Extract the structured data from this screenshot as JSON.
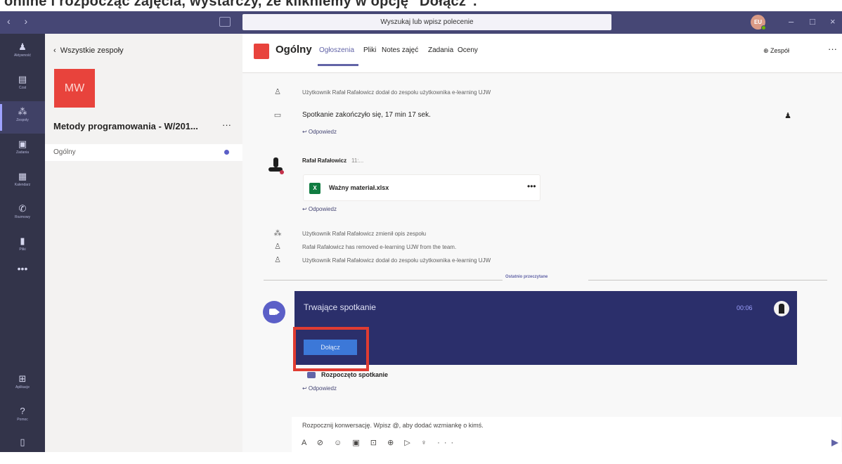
{
  "caption": "online i rozpocząć zajęcia, wystarczy, że klikniemy w opcję \"Dołącz\".",
  "titlebar": {
    "search_placeholder": "Wyszukaj lub wpisz polecenie",
    "avatar_initials": "EU",
    "minimize": "–",
    "maximize": "□",
    "close": "×"
  },
  "rail": {
    "items": [
      {
        "label": "Aktywność",
        "icon": "bell-icon"
      },
      {
        "label": "Czat",
        "icon": "chat-icon"
      },
      {
        "label": "Zespoły",
        "icon": "teams-icon"
      },
      {
        "label": "Zadania",
        "icon": "assignments-icon"
      },
      {
        "label": "Kalendarz",
        "icon": "calendar-icon"
      },
      {
        "label": "Rozmowy",
        "icon": "calls-icon"
      },
      {
        "label": "Pliki",
        "icon": "files-icon"
      }
    ],
    "more": "•••",
    "bottom": [
      {
        "label": "Aplikacje",
        "icon": "apps-icon"
      },
      {
        "label": "Pomoc",
        "icon": "help-icon"
      }
    ]
  },
  "teams_panel": {
    "back_label": "Wszystkie zespoły",
    "team_initials": "MW",
    "team_name": "Metody programowania - W/201...",
    "team_more": "···",
    "channel": "Ogólny"
  },
  "channel_header": {
    "name": "Ogólny",
    "tabs": [
      "Ogłoszenia",
      "Pliki",
      "Notes zajęć",
      "Zadania",
      "Oceny"
    ],
    "team_button": "⊕ Zespół",
    "more": "···"
  },
  "feed": {
    "sys1": "Użytkownik Rafał Rafałowicz dodał do zespołu użytkownika e-learning UJW",
    "meeting_ended": "Spotkanie zakończyło się, 17 min 17 sek.",
    "reply_label": "↩ Odpowiedz",
    "sender_name": "Rafał Rafałowicz",
    "sender_time": "11:...",
    "file_name": "Ważny materiał.xlsx",
    "file_more": "•••",
    "sys2": "Użytkownik Rafał Rafałowicz zmienił opis zespołu",
    "sys3": "Rafał Rafałowicz has removed e-learning UJW from the team.",
    "sys4": "Użytkownik Rafał Rafałowicz dodał do zespołu użytkownika e-learning UJW",
    "divider": "Ostatnio przeczytane"
  },
  "meeting": {
    "title": "Trwające spotkanie",
    "timer": "00:06",
    "join_label": "Dołącz",
    "started_label": "Rozpoczęto spotkanie"
  },
  "compose": {
    "placeholder": "Rozpocznij konwersację. Wpisz @, aby dodać wzmiankę o kimś.",
    "tools": "A ⊘ ☺ ▣ ⊡ ⊕ ▷ ♀ ···"
  },
  "colors": {
    "titlebar": "#464775",
    "rail": "#33344a",
    "accent": "#6264a7",
    "team_tile": "#e8433c",
    "meeting_card": "#2b2f6b",
    "join_button": "#3c78d8",
    "highlight": "#e03c31"
  }
}
